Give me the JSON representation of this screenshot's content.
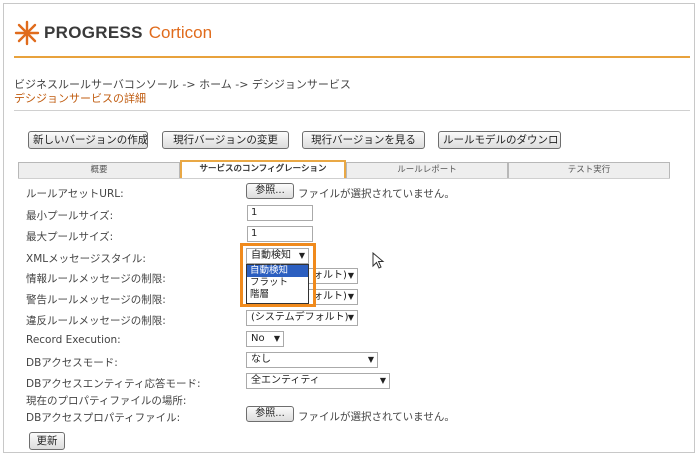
{
  "brand": {
    "name": "PROGRESS",
    "product": "Corticon"
  },
  "breadcrumb": "ビジネスルールサーバコンソール -> ホーム -> デシジョンサービス",
  "subtitle": "デシジョンサービスの詳細",
  "toolbar": {
    "new_version": "新しいバージョンの作成",
    "change_version": "現行バージョンの変更",
    "view_version": "現行バージョンを見る",
    "download_model": "ルールモデルのダウンロ"
  },
  "tabs": [
    "概要",
    "サービスのコンフィグレーション",
    "ルールレポート",
    "テスト実行"
  ],
  "form": {
    "asset_url": {
      "label": "ルールアセットURL:",
      "browse": "参照...",
      "status": "ファイルが選択されていません。"
    },
    "min_pool": {
      "label": "最小プールサイズ:",
      "value": "1"
    },
    "max_pool": {
      "label": "最大プールサイズ:",
      "value": "1"
    },
    "xml_style": {
      "label": "XMLメッセージスタイル:",
      "value": "自動検知"
    },
    "info_limit": {
      "label": "情報ルールメッセージの制限:",
      "value_tail": "ォルト)"
    },
    "warn_limit": {
      "label": "警告ルールメッセージの制限:",
      "value_tail": "ォルト)"
    },
    "violation_limit": {
      "label": "違反ルールメッセージの制限:",
      "value": "(システムデフォルト)"
    },
    "record_execution": {
      "label": "Record Execution:",
      "value": "No"
    },
    "db_access_mode": {
      "label": "DBアクセスモード:",
      "value": "なし"
    },
    "db_entity_mode": {
      "label": "DBアクセスエンティティ応答モード:",
      "value": "全エンティティ"
    },
    "props_location": {
      "label": "現在のプロパティファイルの場所:"
    },
    "db_props_file": {
      "label": "DBアクセスプロパティファイル:",
      "browse": "参照...",
      "status": "ファイルが選択されていません。"
    },
    "update_button": "更新"
  },
  "dropdown_options": [
    "自動検知",
    "フラット",
    "階層"
  ],
  "colors": {
    "accent": "#e06b1c",
    "highlight": "#f08a1c",
    "selected": "#2c5fc0"
  }
}
